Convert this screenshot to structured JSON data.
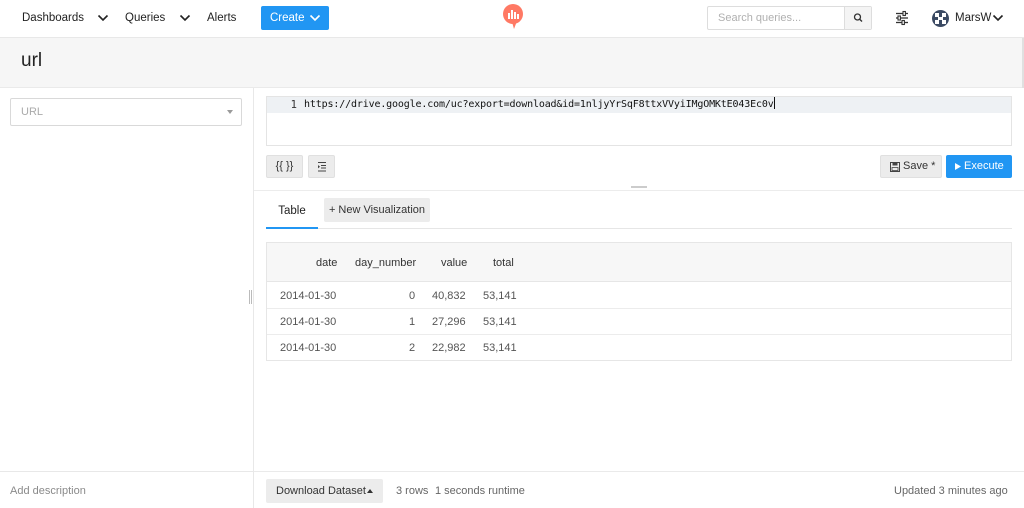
{
  "nav": {
    "dashboards": "Dashboards",
    "queries": "Queries",
    "alerts": "Alerts",
    "create": "Create",
    "search_placeholder": "Search queries...",
    "user_name": "MarsW"
  },
  "query": {
    "title": "url",
    "parameter_placeholder": "URL",
    "add_description": "Add description",
    "line_number": "1",
    "code": "https://drive.google.com/uc?export=download&id=1nljyYrSqF8ttxVVyiIMgOMKtE043Ec0v",
    "params_button": "{{ }}",
    "save_label": "Save *",
    "execute_label": "Execute"
  },
  "tabs": {
    "table": "Table",
    "new_visualization": "+ New Visualization"
  },
  "results": {
    "columns": [
      "date",
      "day_number",
      "value",
      "total"
    ],
    "rows": [
      [
        "2014-01-30",
        "0",
        "40,832",
        "53,141"
      ],
      [
        "2014-01-30",
        "1",
        "27,296",
        "53,141"
      ],
      [
        "2014-01-30",
        "2",
        "22,982",
        "53,141"
      ]
    ]
  },
  "footer": {
    "download_label": "Download Dataset",
    "rows_count": "3 rows",
    "runtime": "1 seconds runtime",
    "updated": "Updated 3 minutes ago"
  },
  "colors": {
    "primary": "#2196f3",
    "logo": "#ff7964"
  },
  "icons": {
    "nav_chevron": "chevron-down-icon",
    "search": "search-icon",
    "settings": "sliders-icon",
    "save": "floppy-disk-icon",
    "execute": "play-icon",
    "indent": "format-indent-icon"
  }
}
